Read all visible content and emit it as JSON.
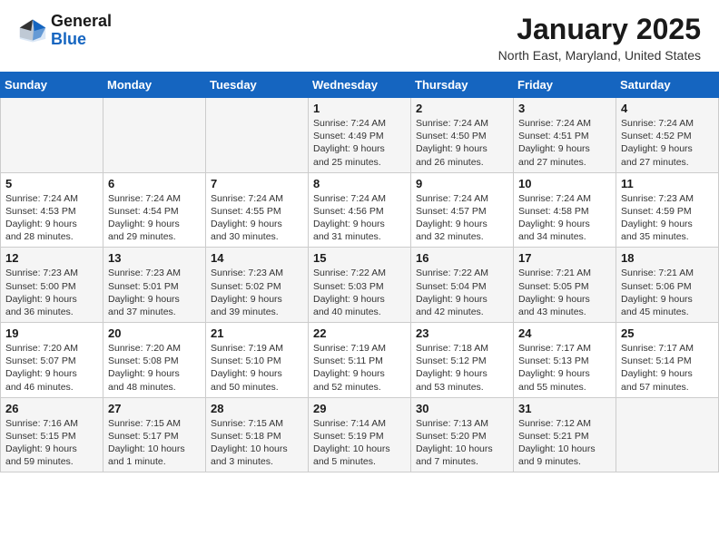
{
  "header": {
    "logo_general": "General",
    "logo_blue": "Blue",
    "month_title": "January 2025",
    "location": "North East, Maryland, United States"
  },
  "days_of_week": [
    "Sunday",
    "Monday",
    "Tuesday",
    "Wednesday",
    "Thursday",
    "Friday",
    "Saturday"
  ],
  "weeks": [
    [
      {
        "day": "",
        "info": ""
      },
      {
        "day": "",
        "info": ""
      },
      {
        "day": "",
        "info": ""
      },
      {
        "day": "1",
        "info": "Sunrise: 7:24 AM\nSunset: 4:49 PM\nDaylight: 9 hours\nand 25 minutes."
      },
      {
        "day": "2",
        "info": "Sunrise: 7:24 AM\nSunset: 4:50 PM\nDaylight: 9 hours\nand 26 minutes."
      },
      {
        "day": "3",
        "info": "Sunrise: 7:24 AM\nSunset: 4:51 PM\nDaylight: 9 hours\nand 27 minutes."
      },
      {
        "day": "4",
        "info": "Sunrise: 7:24 AM\nSunset: 4:52 PM\nDaylight: 9 hours\nand 27 minutes."
      }
    ],
    [
      {
        "day": "5",
        "info": "Sunrise: 7:24 AM\nSunset: 4:53 PM\nDaylight: 9 hours\nand 28 minutes."
      },
      {
        "day": "6",
        "info": "Sunrise: 7:24 AM\nSunset: 4:54 PM\nDaylight: 9 hours\nand 29 minutes."
      },
      {
        "day": "7",
        "info": "Sunrise: 7:24 AM\nSunset: 4:55 PM\nDaylight: 9 hours\nand 30 minutes."
      },
      {
        "day": "8",
        "info": "Sunrise: 7:24 AM\nSunset: 4:56 PM\nDaylight: 9 hours\nand 31 minutes."
      },
      {
        "day": "9",
        "info": "Sunrise: 7:24 AM\nSunset: 4:57 PM\nDaylight: 9 hours\nand 32 minutes."
      },
      {
        "day": "10",
        "info": "Sunrise: 7:24 AM\nSunset: 4:58 PM\nDaylight: 9 hours\nand 34 minutes."
      },
      {
        "day": "11",
        "info": "Sunrise: 7:23 AM\nSunset: 4:59 PM\nDaylight: 9 hours\nand 35 minutes."
      }
    ],
    [
      {
        "day": "12",
        "info": "Sunrise: 7:23 AM\nSunset: 5:00 PM\nDaylight: 9 hours\nand 36 minutes."
      },
      {
        "day": "13",
        "info": "Sunrise: 7:23 AM\nSunset: 5:01 PM\nDaylight: 9 hours\nand 37 minutes."
      },
      {
        "day": "14",
        "info": "Sunrise: 7:23 AM\nSunset: 5:02 PM\nDaylight: 9 hours\nand 39 minutes."
      },
      {
        "day": "15",
        "info": "Sunrise: 7:22 AM\nSunset: 5:03 PM\nDaylight: 9 hours\nand 40 minutes."
      },
      {
        "day": "16",
        "info": "Sunrise: 7:22 AM\nSunset: 5:04 PM\nDaylight: 9 hours\nand 42 minutes."
      },
      {
        "day": "17",
        "info": "Sunrise: 7:21 AM\nSunset: 5:05 PM\nDaylight: 9 hours\nand 43 minutes."
      },
      {
        "day": "18",
        "info": "Sunrise: 7:21 AM\nSunset: 5:06 PM\nDaylight: 9 hours\nand 45 minutes."
      }
    ],
    [
      {
        "day": "19",
        "info": "Sunrise: 7:20 AM\nSunset: 5:07 PM\nDaylight: 9 hours\nand 46 minutes."
      },
      {
        "day": "20",
        "info": "Sunrise: 7:20 AM\nSunset: 5:08 PM\nDaylight: 9 hours\nand 48 minutes."
      },
      {
        "day": "21",
        "info": "Sunrise: 7:19 AM\nSunset: 5:10 PM\nDaylight: 9 hours\nand 50 minutes."
      },
      {
        "day": "22",
        "info": "Sunrise: 7:19 AM\nSunset: 5:11 PM\nDaylight: 9 hours\nand 52 minutes."
      },
      {
        "day": "23",
        "info": "Sunrise: 7:18 AM\nSunset: 5:12 PM\nDaylight: 9 hours\nand 53 minutes."
      },
      {
        "day": "24",
        "info": "Sunrise: 7:17 AM\nSunset: 5:13 PM\nDaylight: 9 hours\nand 55 minutes."
      },
      {
        "day": "25",
        "info": "Sunrise: 7:17 AM\nSunset: 5:14 PM\nDaylight: 9 hours\nand 57 minutes."
      }
    ],
    [
      {
        "day": "26",
        "info": "Sunrise: 7:16 AM\nSunset: 5:15 PM\nDaylight: 9 hours\nand 59 minutes."
      },
      {
        "day": "27",
        "info": "Sunrise: 7:15 AM\nSunset: 5:17 PM\nDaylight: 10 hours\nand 1 minute."
      },
      {
        "day": "28",
        "info": "Sunrise: 7:15 AM\nSunset: 5:18 PM\nDaylight: 10 hours\nand 3 minutes."
      },
      {
        "day": "29",
        "info": "Sunrise: 7:14 AM\nSunset: 5:19 PM\nDaylight: 10 hours\nand 5 minutes."
      },
      {
        "day": "30",
        "info": "Sunrise: 7:13 AM\nSunset: 5:20 PM\nDaylight: 10 hours\nand 7 minutes."
      },
      {
        "day": "31",
        "info": "Sunrise: 7:12 AM\nSunset: 5:21 PM\nDaylight: 10 hours\nand 9 minutes."
      },
      {
        "day": "",
        "info": ""
      }
    ]
  ]
}
